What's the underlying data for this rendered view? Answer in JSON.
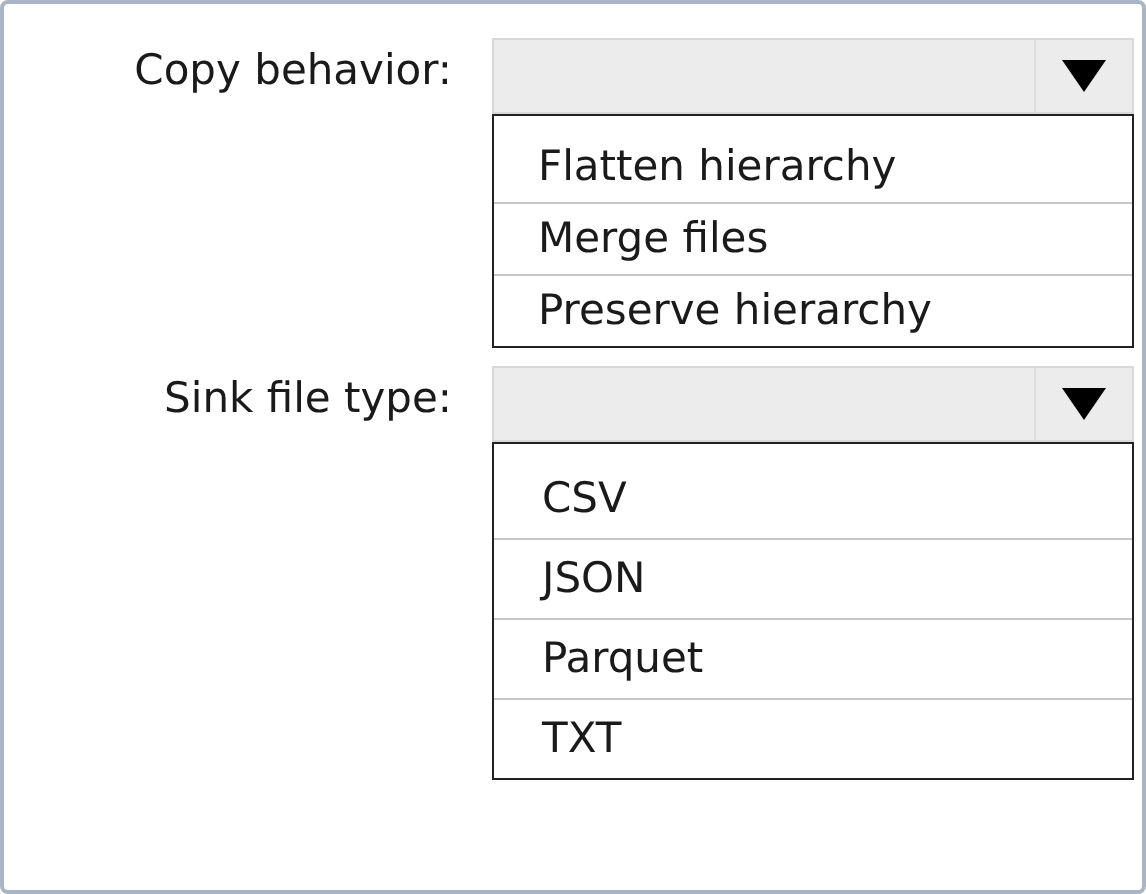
{
  "fields": [
    {
      "label": "Copy behavior:",
      "options": [
        "Flatten hierarchy",
        "Merge files",
        "Preserve hierarchy"
      ]
    },
    {
      "label": "Sink file type:",
      "options": [
        "CSV",
        "JSON",
        "Parquet",
        "TXT"
      ]
    }
  ]
}
